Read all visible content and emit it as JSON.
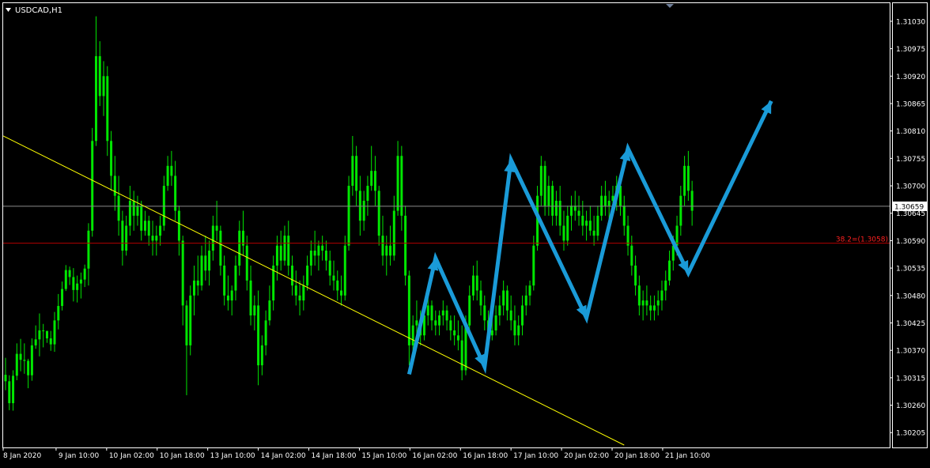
{
  "window": {
    "symbol_label": "USDCAD,H1"
  },
  "colors": {
    "background": "#000000",
    "frame": "#FFFFFF",
    "candle": "#00E600",
    "trendline": "#FFFF00",
    "fib_line": "#B30000",
    "fib_text": "#FF2020",
    "price_line": "#8A8A8A",
    "arrows": "#1A9BD8",
    "axis_text": "#FFFFFF"
  },
  "icons": {
    "menu": "triangle-down-icon",
    "scroll_marker": "triangle-down-icon"
  },
  "chart_data": {
    "type": "candlestick",
    "title": "USDCAD,H1",
    "ylim": [
      1.3018,
      1.3106
    ],
    "y_ticks": [
      "1.31030",
      "1.30975",
      "1.30920",
      "1.30865",
      "1.30810",
      "1.30755",
      "1.30700",
      "1.30645",
      "1.30590",
      "1.30535",
      "1.30480",
      "1.30425",
      "1.30370",
      "1.30315",
      "1.30260",
      "1.30205"
    ],
    "x_ticks": [
      "8 Jan 2020",
      "9 Jan 10:00",
      "10 Jan 02:00",
      "10 Jan 18:00",
      "13 Jan 10:00",
      "14 Jan 02:00",
      "14 Jan 18:00",
      "15 Jan 10:00",
      "16 Jan 02:00",
      "16 Jan 18:00",
      "17 Jan 10:00",
      "20 Jan 02:00",
      "20 Jan 18:00",
      "21 Jan 10:00"
    ],
    "current_price": {
      "label": "1.30659",
      "value": 1.30659
    },
    "fibonacci": {
      "label": "38.2=(1.3058)",
      "value": 1.30585
    },
    "trendline": {
      "from": {
        "bar": 0,
        "price": 1.308
      },
      "to": {
        "bar": 164,
        "price": 1.3018
      }
    },
    "candles": [
      [
        1.30321,
        1.30355,
        1.3029,
        1.30308
      ],
      [
        1.30308,
        1.3032,
        1.3025,
        1.30264
      ],
      [
        1.30264,
        1.3033,
        1.30249,
        1.30319
      ],
      [
        1.30319,
        1.30384,
        1.3031,
        1.30363
      ],
      [
        1.30363,
        1.30393,
        1.30328,
        1.30351
      ],
      [
        1.30351,
        1.30384,
        1.30323,
        1.30349
      ],
      [
        1.30349,
        1.30353,
        1.30294,
        1.3032
      ],
      [
        1.3032,
        1.30394,
        1.30309,
        1.3038
      ],
      [
        1.3038,
        1.3042,
        1.30373,
        1.30392
      ],
      [
        1.30392,
        1.30444,
        1.30358,
        1.3041
      ],
      [
        1.3041,
        1.30423,
        1.30376,
        1.30409
      ],
      [
        1.30409,
        1.30409,
        1.30385,
        1.30394
      ],
      [
        1.30394,
        1.30409,
        1.30369,
        1.30382
      ],
      [
        1.30382,
        1.30447,
        1.30367,
        1.3043
      ],
      [
        1.3043,
        1.30483,
        1.30412,
        1.30459
      ],
      [
        1.30459,
        1.30508,
        1.3045,
        1.30493
      ],
      [
        1.30493,
        1.30541,
        1.30489,
        1.30531
      ],
      [
        1.30531,
        1.30538,
        1.30501,
        1.30517
      ],
      [
        1.30517,
        1.30535,
        1.30468,
        1.30491
      ],
      [
        1.30491,
        1.3052,
        1.30466,
        1.30504
      ],
      [
        1.30504,
        1.30526,
        1.30474,
        1.30512
      ],
      [
        1.30512,
        1.30542,
        1.30497,
        1.30534
      ],
      [
        1.30534,
        1.30625,
        1.305,
        1.3061
      ],
      [
        1.3061,
        1.30816,
        1.30598,
        1.3079
      ],
      [
        1.3079,
        1.3104,
        1.3078,
        1.3096
      ],
      [
        1.3096,
        1.3099,
        1.3086,
        1.3088
      ],
      [
        1.3088,
        1.3095,
        1.3084,
        1.3092
      ],
      [
        1.3092,
        1.3094,
        1.3076,
        1.3079
      ],
      [
        1.3079,
        1.3081,
        1.3069,
        1.3072
      ],
      [
        1.3072,
        1.3076,
        1.3065,
        1.3068
      ],
      [
        1.3068,
        1.3072,
        1.306,
        1.3063
      ],
      [
        1.3063,
        1.3065,
        1.3054,
        1.3057
      ],
      [
        1.3057,
        1.3064,
        1.3056,
        1.3062
      ],
      [
        1.3062,
        1.307,
        1.306,
        1.3067
      ],
      [
        1.3067,
        1.3069,
        1.3061,
        1.3064
      ],
      [
        1.3064,
        1.3068,
        1.3062,
        1.3066
      ],
      [
        1.3066,
        1.3067,
        1.3059,
        1.3061
      ],
      [
        1.3061,
        1.3065,
        1.306,
        1.3063
      ],
      [
        1.3063,
        1.3064,
        1.3058,
        1.306
      ],
      [
        1.306,
        1.3063,
        1.3056,
        1.3059
      ],
      [
        1.3059,
        1.3062,
        1.3056,
        1.306
      ],
      [
        1.306,
        1.3064,
        1.3058,
        1.3062
      ],
      [
        1.3062,
        1.3072,
        1.3061,
        1.307
      ],
      [
        1.307,
        1.3076,
        1.3069,
        1.3074
      ],
      [
        1.3074,
        1.3077,
        1.307,
        1.3072
      ],
      [
        1.3072,
        1.3075,
        1.3063,
        1.3065
      ],
      [
        1.3065,
        1.3066,
        1.3056,
        1.3059
      ],
      [
        1.3059,
        1.306,
        1.3042,
        1.3046
      ],
      [
        1.3046,
        1.3047,
        1.3028,
        1.3038
      ],
      [
        1.3038,
        1.305,
        1.3036,
        1.3048
      ],
      [
        1.3048,
        1.3054,
        1.3044,
        1.3051
      ],
      [
        1.3051,
        1.3056,
        1.3048,
        1.305
      ],
      [
        1.305,
        1.3058,
        1.3049,
        1.3056
      ],
      [
        1.3056,
        1.306,
        1.3051,
        1.3053
      ],
      [
        1.3053,
        1.3059,
        1.305,
        1.3057
      ],
      [
        1.3057,
        1.3064,
        1.3055,
        1.3062
      ],
      [
        1.3062,
        1.3067,
        1.3059,
        1.3061
      ],
      [
        1.3061,
        1.3062,
        1.3052,
        1.3054
      ],
      [
        1.3054,
        1.3056,
        1.3046,
        1.3048
      ],
      [
        1.3048,
        1.3052,
        1.3045,
        1.3047
      ],
      [
        1.3047,
        1.305,
        1.3044,
        1.3049
      ],
      [
        1.3049,
        1.3056,
        1.3047,
        1.3054
      ],
      [
        1.3054,
        1.3063,
        1.3052,
        1.3061
      ],
      [
        1.3061,
        1.3065,
        1.3056,
        1.3058
      ],
      [
        1.3058,
        1.306,
        1.3049,
        1.3051
      ],
      [
        1.3051,
        1.3054,
        1.3042,
        1.3044
      ],
      [
        1.3044,
        1.3048,
        1.3041,
        1.3046
      ],
      [
        1.3046,
        1.3049,
        1.303,
        1.3034
      ],
      [
        1.3034,
        1.304,
        1.3032,
        1.3038
      ],
      [
        1.3038,
        1.3045,
        1.3036,
        1.3043
      ],
      [
        1.3043,
        1.305,
        1.3042,
        1.3047
      ],
      [
        1.3047,
        1.3056,
        1.3045,
        1.3054
      ],
      [
        1.3054,
        1.306,
        1.3051,
        1.3058
      ],
      [
        1.3058,
        1.3061,
        1.3053,
        1.3055
      ],
      [
        1.3055,
        1.3062,
        1.3054,
        1.306
      ],
      [
        1.306,
        1.3063,
        1.3052,
        1.3054
      ],
      [
        1.3054,
        1.3056,
        1.3048,
        1.305
      ],
      [
        1.305,
        1.3053,
        1.3046,
        1.3048
      ],
      [
        1.3048,
        1.3051,
        1.3044,
        1.3047
      ],
      [
        1.3047,
        1.3052,
        1.3045,
        1.305
      ],
      [
        1.305,
        1.3056,
        1.3049,
        1.3054
      ],
      [
        1.3054,
        1.3059,
        1.3052,
        1.3057
      ],
      [
        1.3057,
        1.3061,
        1.3054,
        1.3056
      ],
      [
        1.3056,
        1.3059,
        1.3053,
        1.3058
      ],
      [
        1.3058,
        1.306,
        1.3055,
        1.3057
      ],
      [
        1.3057,
        1.3059,
        1.3053,
        1.3055
      ],
      [
        1.3055,
        1.3057,
        1.305,
        1.3052
      ],
      [
        1.3052,
        1.3055,
        1.3049,
        1.3051
      ],
      [
        1.3051,
        1.3053,
        1.3047,
        1.3049
      ],
      [
        1.3049,
        1.3052,
        1.3046,
        1.3048
      ],
      [
        1.3048,
        1.306,
        1.3047,
        1.3058
      ],
      [
        1.3058,
        1.3072,
        1.3057,
        1.307
      ],
      [
        1.307,
        1.308,
        1.3068,
        1.3076
      ],
      [
        1.3076,
        1.3078,
        1.3066,
        1.3069
      ],
      [
        1.3069,
        1.3072,
        1.306,
        1.3063
      ],
      [
        1.3063,
        1.3069,
        1.3061,
        1.3067
      ],
      [
        1.3067,
        1.3072,
        1.3064,
        1.307
      ],
      [
        1.307,
        1.3078,
        1.3069,
        1.3073
      ],
      [
        1.3073,
        1.3076,
        1.3066,
        1.3069
      ],
      [
        1.3069,
        1.307,
        1.3058,
        1.306
      ],
      [
        1.306,
        1.3064,
        1.3054,
        1.3056
      ],
      [
        1.3056,
        1.306,
        1.3052,
        1.3058
      ],
      [
        1.3058,
        1.3062,
        1.3054,
        1.3056
      ],
      [
        1.3056,
        1.3068,
        1.3055,
        1.3065
      ],
      [
        1.3065,
        1.3079,
        1.3064,
        1.3076
      ],
      [
        1.3076,
        1.3078,
        1.3061,
        1.3064
      ],
      [
        1.3064,
        1.3066,
        1.305,
        1.3052
      ],
      [
        1.3052,
        1.3053,
        1.3034,
        1.3038
      ],
      [
        1.3038,
        1.3044,
        1.3035,
        1.3042
      ],
      [
        1.3042,
        1.3047,
        1.304,
        1.3043
      ],
      [
        1.3043,
        1.3045,
        1.3038,
        1.304
      ],
      [
        1.304,
        1.3046,
        1.3039,
        1.3044
      ],
      [
        1.3044,
        1.3048,
        1.3042,
        1.3046
      ],
      [
        1.3046,
        1.3047,
        1.3041,
        1.3043
      ],
      [
        1.3043,
        1.3045,
        1.304,
        1.3042
      ],
      [
        1.3042,
        1.3045,
        1.304,
        1.3044
      ],
      [
        1.3044,
        1.3047,
        1.3042,
        1.3045
      ],
      [
        1.3045,
        1.3046,
        1.3041,
        1.3043
      ],
      [
        1.3043,
        1.3044,
        1.3039,
        1.3041
      ],
      [
        1.3041,
        1.3044,
        1.3038,
        1.304
      ],
      [
        1.304,
        1.3043,
        1.3037,
        1.3039
      ],
      [
        1.3039,
        1.3042,
        1.3031,
        1.3033
      ],
      [
        1.3033,
        1.3044,
        1.3032,
        1.3042
      ],
      [
        1.3042,
        1.305,
        1.3041,
        1.3048
      ],
      [
        1.3048,
        1.3054,
        1.3047,
        1.3052
      ],
      [
        1.3052,
        1.3055,
        1.3047,
        1.3049
      ],
      [
        1.3049,
        1.3051,
        1.3044,
        1.3046
      ],
      [
        1.3046,
        1.3048,
        1.3041,
        1.3043
      ],
      [
        1.3043,
        1.3045,
        1.3038,
        1.304
      ],
      [
        1.304,
        1.3043,
        1.3039,
        1.3041
      ],
      [
        1.3041,
        1.3046,
        1.304,
        1.3044
      ],
      [
        1.3044,
        1.3048,
        1.3042,
        1.3046
      ],
      [
        1.3046,
        1.3051,
        1.3044,
        1.3049
      ],
      [
        1.3049,
        1.305,
        1.3043,
        1.3045
      ],
      [
        1.3045,
        1.3048,
        1.3041,
        1.3043
      ],
      [
        1.3043,
        1.3046,
        1.3038,
        1.304
      ],
      [
        1.304,
        1.3044,
        1.3038,
        1.3042
      ],
      [
        1.3042,
        1.3048,
        1.304,
        1.3046
      ],
      [
        1.3046,
        1.305,
        1.3044,
        1.3048
      ],
      [
        1.3048,
        1.3051,
        1.3046,
        1.305
      ],
      [
        1.305,
        1.306,
        1.3049,
        1.3058
      ],
      [
        1.3058,
        1.307,
        1.3057,
        1.3068
      ],
      [
        1.3068,
        1.3076,
        1.3066,
        1.3074
      ],
      [
        1.3074,
        1.3075,
        1.3064,
        1.3066
      ],
      [
        1.3066,
        1.3072,
        1.3064,
        1.307
      ],
      [
        1.307,
        1.3071,
        1.3062,
        1.3064
      ],
      [
        1.3064,
        1.3069,
        1.3062,
        1.3067
      ],
      [
        1.3067,
        1.307,
        1.306,
        1.3062
      ],
      [
        1.3062,
        1.3065,
        1.3057,
        1.3059
      ],
      [
        1.3059,
        1.3066,
        1.3058,
        1.3064
      ],
      [
        1.3064,
        1.3068,
        1.3061,
        1.3066
      ],
      [
        1.3066,
        1.3069,
        1.3063,
        1.3065
      ],
      [
        1.3065,
        1.3068,
        1.3062,
        1.3064
      ],
      [
        1.3064,
        1.3067,
        1.306,
        1.3062
      ],
      [
        1.3062,
        1.3065,
        1.3059,
        1.3063
      ],
      [
        1.3063,
        1.3066,
        1.306,
        1.3061
      ],
      [
        1.3061,
        1.3064,
        1.3058,
        1.306
      ],
      [
        1.306,
        1.3066,
        1.3059,
        1.3064
      ],
      [
        1.3064,
        1.307,
        1.3063,
        1.3068
      ],
      [
        1.3068,
        1.3071,
        1.3064,
        1.3066
      ],
      [
        1.3066,
        1.3069,
        1.3063,
        1.3067
      ],
      [
        1.3067,
        1.307,
        1.3064,
        1.3068
      ],
      [
        1.3068,
        1.3072,
        1.3065,
        1.307
      ],
      [
        1.307,
        1.3071,
        1.3064,
        1.3066
      ],
      [
        1.3066,
        1.3068,
        1.306,
        1.3062
      ],
      [
        1.3062,
        1.3064,
        1.3056,
        1.3058
      ],
      [
        1.3058,
        1.306,
        1.3052,
        1.3054
      ],
      [
        1.3054,
        1.3056,
        1.3048,
        1.305
      ],
      [
        1.305,
        1.3052,
        1.3044,
        1.3046
      ],
      [
        1.3046,
        1.3049,
        1.3043,
        1.3047
      ],
      [
        1.3047,
        1.305,
        1.3044,
        1.3046
      ],
      [
        1.3046,
        1.3048,
        1.3043,
        1.3045
      ],
      [
        1.3045,
        1.3048,
        1.3043,
        1.3046
      ],
      [
        1.3046,
        1.3049,
        1.3044,
        1.3047
      ],
      [
        1.3047,
        1.3051,
        1.3045,
        1.3049
      ],
      [
        1.3049,
        1.3053,
        1.3047,
        1.3051
      ],
      [
        1.3051,
        1.3057,
        1.305,
        1.3055
      ],
      [
        1.3055,
        1.306,
        1.3053,
        1.3058
      ],
      [
        1.3058,
        1.3064,
        1.3056,
        1.3062
      ],
      [
        1.3062,
        1.307,
        1.306,
        1.3068
      ],
      [
        1.3068,
        1.3076,
        1.3066,
        1.3074
      ],
      [
        1.3074,
        1.3077,
        1.3067,
        1.3069
      ],
      [
        1.3069,
        1.3071,
        1.3062,
        1.3065
      ]
    ],
    "arrows": [
      {
        "name": "zigzag-arrow",
        "points": [
          {
            "bar": 107,
            "price": 1.30322
          },
          {
            "bar": 114,
            "price": 1.30555
          },
          {
            "bar": 127,
            "price": 1.30337
          },
          {
            "bar": 134,
            "price": 1.30752
          },
          {
            "bar": 154,
            "price": 1.30435
          },
          {
            "bar": 165,
            "price": 1.30775
          },
          {
            "bar": 181,
            "price": 1.30525
          },
          {
            "bar": 203,
            "price": 1.3087
          }
        ]
      }
    ]
  }
}
